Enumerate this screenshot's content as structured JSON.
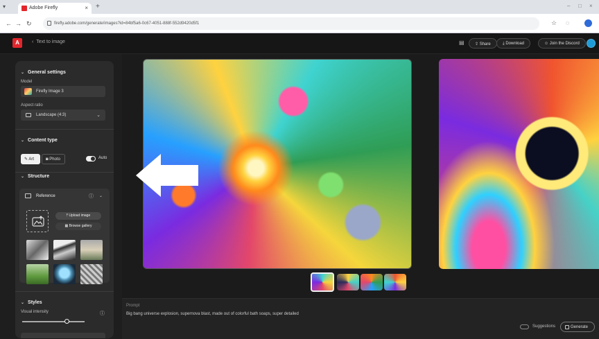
{
  "browser": {
    "tab_title": "Adobe Firefly",
    "tab_close": "×",
    "new_tab": "+",
    "url": "firefly.adobe.com/generate/images?id=84bf5a6-0c67-4051-888f-552d9420d5f1"
  },
  "header": {
    "back_label": "Text to image",
    "share_label": "Share",
    "download_label": "Download",
    "discord_label": "Join the Discord"
  },
  "panel": {
    "general_title": "General settings",
    "model_label": "Model",
    "model_value": "Firefly Image 3",
    "aspect_label": "Aspect ratio",
    "aspect_value": "Landscape (4:3)",
    "content_title": "Content type",
    "art_label": "Art",
    "photo_label": "Photo",
    "auto_label": "Auto",
    "structure_title": "Structure",
    "reference_label": "Reference",
    "upload_label": "Upload image",
    "browse_label": "Browse gallery",
    "styles_title": "Styles",
    "intensity_label": "Visual intensity",
    "intensity_level": 0.72
  },
  "prompt": {
    "label": "Prompt",
    "text": "Big bang universe explosion, supernova blast, made out of colorful bath soaps, super detailed",
    "suggestions_label": "Suggestions",
    "generate_label": "Generate"
  },
  "colors": {
    "accent": "#e3262c",
    "panel_bg": "#2b2b2b",
    "app_bg": "#1b1b1b"
  }
}
